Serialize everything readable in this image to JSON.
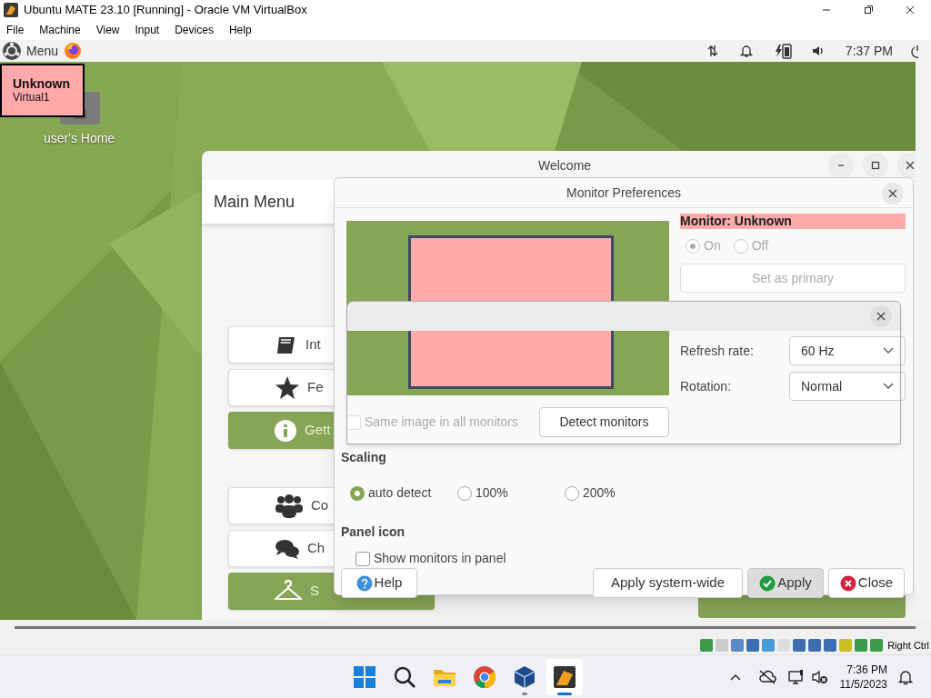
{
  "window": {
    "title": "Ubuntu MATE 23.10 [Running] - Oracle VM VirtualBox"
  },
  "menu_bar": [
    "File",
    "Machine",
    "View",
    "Input",
    "Devices",
    "Help"
  ],
  "guest_panel": {
    "menu_label": "Menu",
    "clock": "7:37 PM"
  },
  "monitor_label": {
    "name": "Unknown",
    "output": "Virtual1"
  },
  "desktop_icons": [
    {
      "label": "user's Home"
    }
  ],
  "welcome": {
    "title": "Welcome",
    "header": "Main Menu",
    "button_groups": [
      [
        {
          "label": "Int",
          "kind": "book",
          "primary": false
        },
        {
          "label": "Fe",
          "kind": "star",
          "primary": false
        },
        {
          "label": "Gett",
          "kind": "info",
          "primary": true
        }
      ],
      [
        {
          "label": "Co",
          "kind": "people",
          "primary": false
        },
        {
          "label": "Ch",
          "kind": "chat",
          "primary": false
        },
        {
          "label": "S",
          "kind": "hanger",
          "primary": true
        }
      ]
    ]
  },
  "monitor_prefs": {
    "title": "Monitor Preferences",
    "monitor_heading": "Monitor: Unknown",
    "power_disabled": true,
    "power_options": [
      {
        "label": "On",
        "selected": true
      },
      {
        "label": "Off",
        "selected": false
      }
    ],
    "set_primary": {
      "label": "Set as primary",
      "disabled": true
    },
    "settings": [
      {
        "label": "Refresh rate:",
        "value": "60 Hz"
      },
      {
        "label": "Rotation:",
        "value": "Normal"
      }
    ],
    "same_image": {
      "label": "Same image in all monitors",
      "checked": false,
      "disabled": true
    },
    "detect_button": "Detect monitors",
    "scaling": {
      "heading": "Scaling",
      "options": [
        {
          "label": "auto detect",
          "selected": true
        },
        {
          "label": "100%",
          "selected": false
        },
        {
          "label": "200%",
          "selected": false
        }
      ]
    },
    "panel_icon": {
      "heading": "Panel icon",
      "option": {
        "label": "Show monitors in panel",
        "checked": false
      }
    },
    "buttons": [
      {
        "label": "Help",
        "kind": "help",
        "hovered": false
      },
      {
        "label": "Apply system-wide",
        "kind": "plain",
        "hovered": false
      },
      {
        "label": "Apply",
        "kind": "apply",
        "hovered": true
      },
      {
        "label": "Close",
        "kind": "close",
        "hovered": false
      }
    ]
  },
  "status_bar": {
    "host_key": "Right Ctrl"
  },
  "taskbar": {
    "apps": [
      {
        "kind": "start",
        "running": false,
        "active": false
      },
      {
        "kind": "search",
        "running": false,
        "active": false
      },
      {
        "kind": "folder",
        "running": false,
        "active": false
      },
      {
        "kind": "browser",
        "running": false,
        "active": false
      },
      {
        "kind": "cube",
        "running": true,
        "active": false
      },
      {
        "kind": "vm",
        "running": true,
        "active": true
      }
    ],
    "time": "7:36 PM",
    "date": "11/5/2023"
  }
}
